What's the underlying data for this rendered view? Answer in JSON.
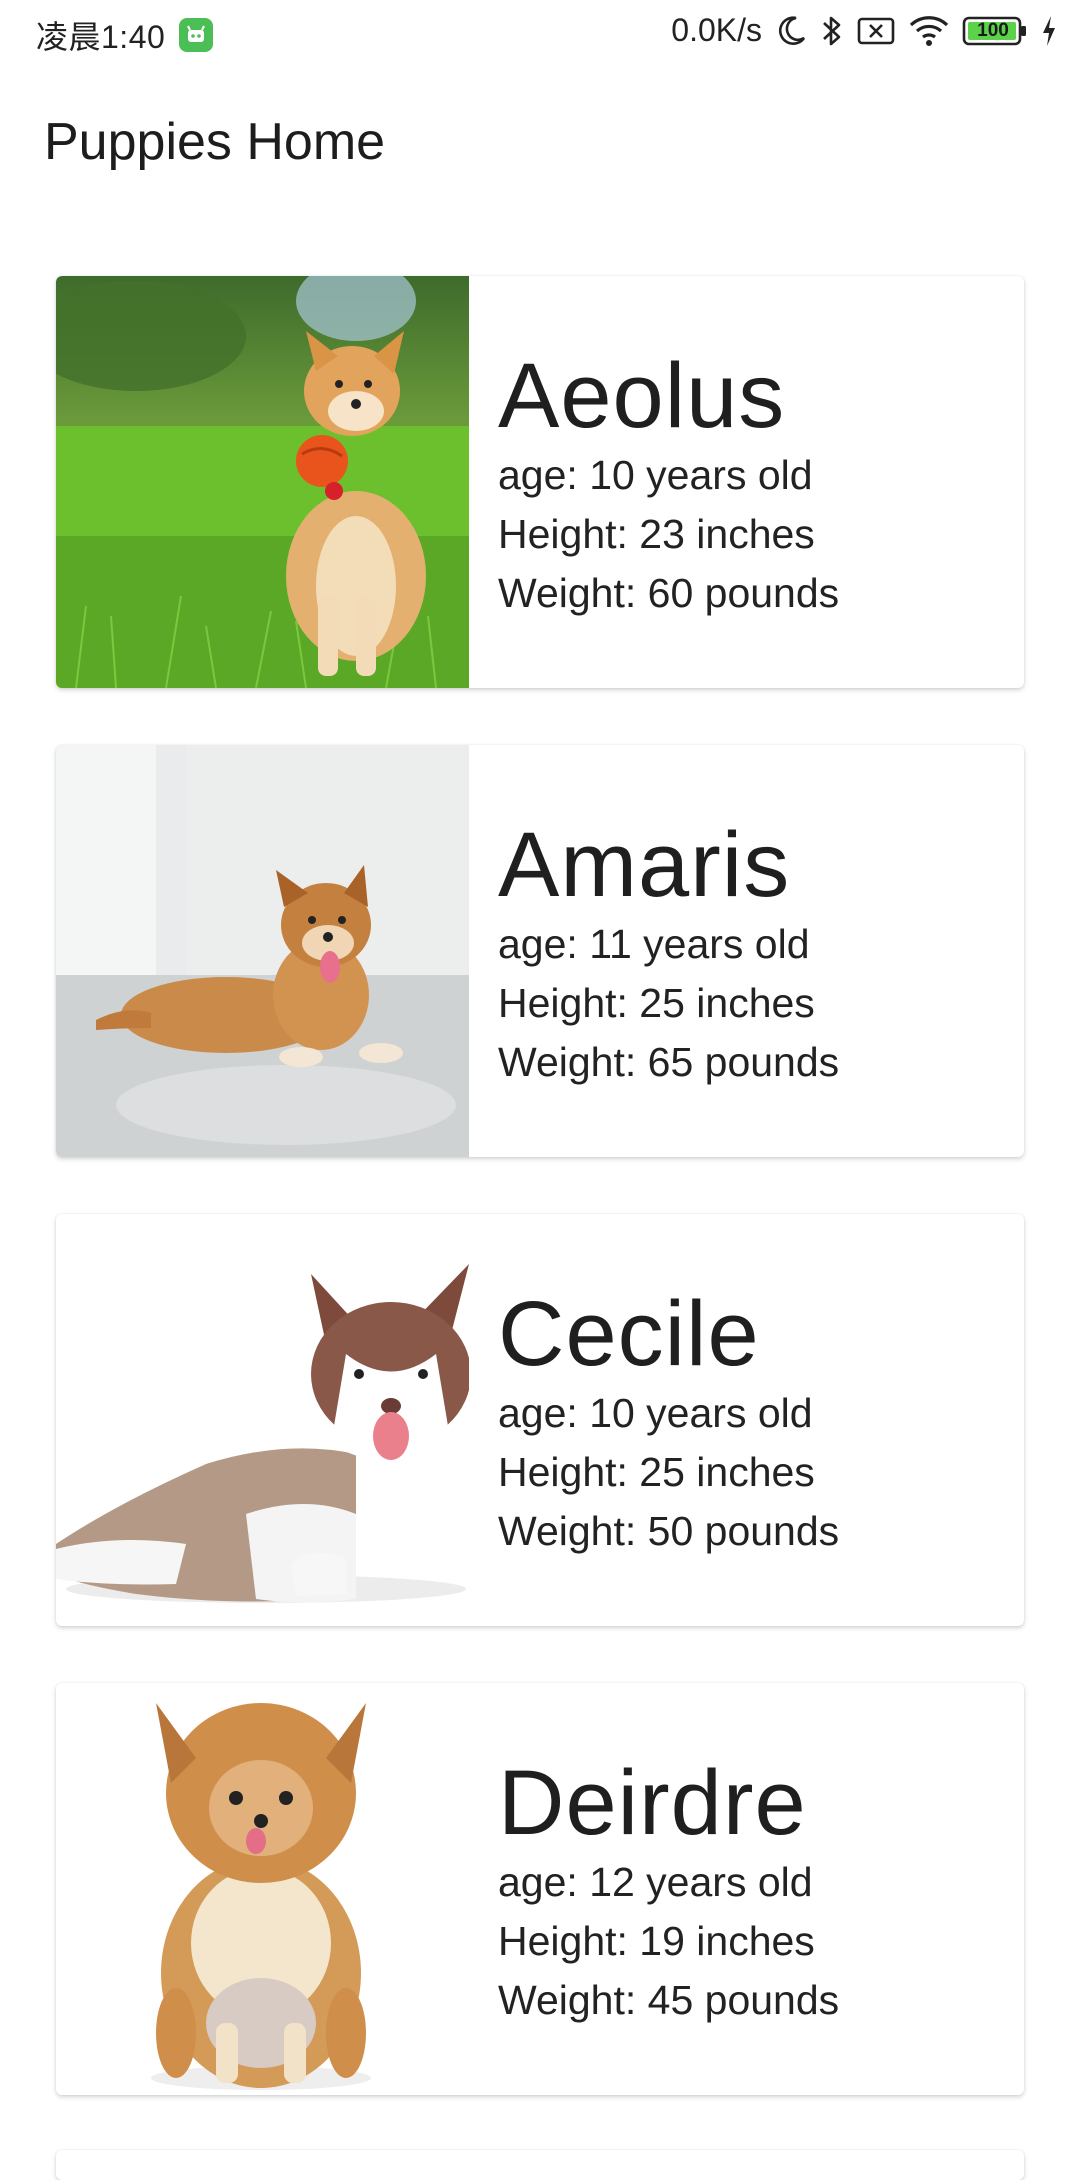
{
  "status_bar": {
    "time": "凌晨1:40",
    "net_speed": "0.0K/s",
    "battery": "100",
    "icons": [
      "app-notification-icon",
      "moon-icon",
      "bluetooth-icon",
      "sim-disabled-icon",
      "wifi-icon",
      "battery-icon",
      "charging-icon"
    ]
  },
  "header": {
    "title": "Puppies Home"
  },
  "puppies": [
    {
      "name": "Aeolus",
      "age": "age: 10 years old",
      "height": "Height: 23 inches",
      "weight": "Weight: 60 pounds",
      "image": "shiba-on-grass-with-ball"
    },
    {
      "name": "Amaris",
      "age": "age: 11 years old",
      "height": "Height: 25 inches",
      "weight": "Weight: 65 pounds",
      "image": "shiba-lying-on-floor"
    },
    {
      "name": "Cecile",
      "age": "age: 10 years old",
      "height": "Height: 25 inches",
      "weight": "Weight: 50 pounds",
      "image": "husky-lying-white-bg"
    },
    {
      "name": "Deirdre",
      "age": "age: 12 years old",
      "height": "Height: 19 inches",
      "weight": "Weight: 45 pounds",
      "image": "pomeranian-sitting"
    }
  ],
  "colors": {
    "app_badge": "#4bbf55",
    "battery_fill": "#5bd24a"
  }
}
